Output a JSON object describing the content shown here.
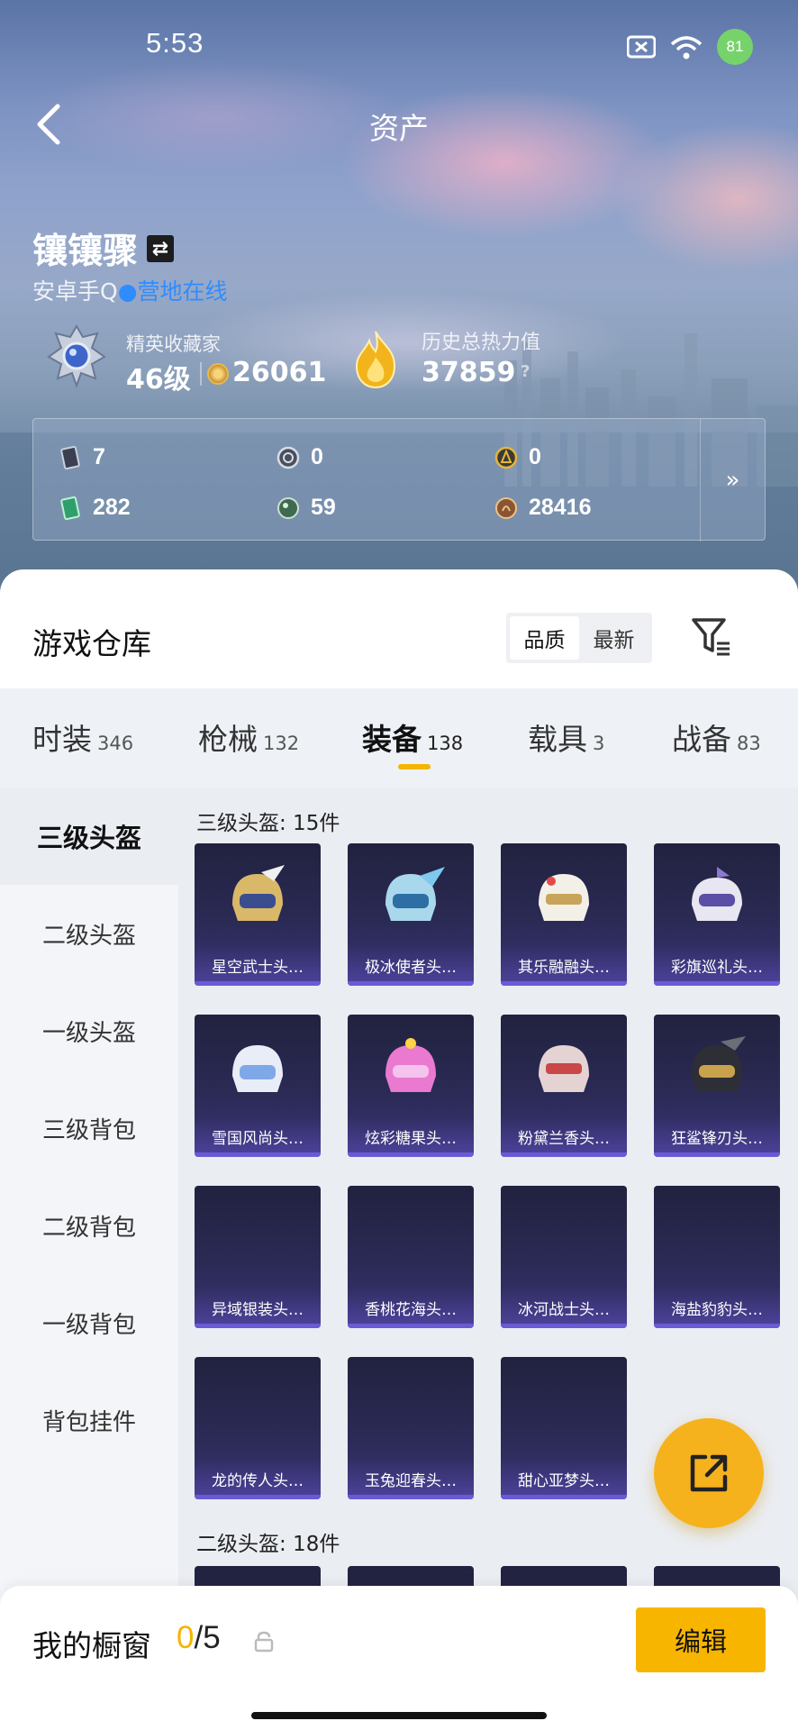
{
  "status_bar": {
    "time": "5:53",
    "battery": "81"
  },
  "header": {
    "title": "资产"
  },
  "user": {
    "name": "镶镶骤",
    "platform": "安卓手Q",
    "status": "营地在线",
    "rank_title": "精英收藏家",
    "level": "46级",
    "coins": "26061",
    "heat_title": "历史总热力值",
    "heat_value": "37859",
    "heat_help": "?"
  },
  "currencies": [
    {
      "icon": "card-icon",
      "value": "7"
    },
    {
      "icon": "silver-coin-icon",
      "value": "0"
    },
    {
      "icon": "gold-coin-icon",
      "value": "0"
    },
    {
      "icon": "green-ticket-icon",
      "value": "282"
    },
    {
      "icon": "orb-icon",
      "value": "59"
    },
    {
      "icon": "bronze-coin-icon",
      "value": "28416"
    }
  ],
  "currency_more": "»",
  "warehouse": {
    "title": "游戏仓库",
    "sort_quality": "品质",
    "sort_latest": "最新"
  },
  "tabs": [
    {
      "label": "时装",
      "count": "346"
    },
    {
      "label": "枪械",
      "count": "132"
    },
    {
      "label": "装备",
      "count": "138"
    },
    {
      "label": "载具",
      "count": "3"
    },
    {
      "label": "战备",
      "count": "83"
    }
  ],
  "active_tab": "装备",
  "sidebar": [
    "三级头盔",
    "二级头盔",
    "一级头盔",
    "三级背包",
    "二级背包",
    "一级背包",
    "背包挂件"
  ],
  "sections": [
    {
      "title": "三级头盔: 15件",
      "items": [
        "星空武士头…",
        "极冰使者头…",
        "其乐融融头…",
        "彩旗巡礼头…",
        "雪国风尚头…",
        "炫彩糖果头…",
        "粉黛兰香头…",
        "狂鲨锋刃头…",
        "异域银装头…",
        "香桃花海头…",
        "冰河战士头…",
        "海盐豹豹头…",
        "龙的传人头…",
        "玉兔迎春头…",
        "甜心亚梦头…"
      ]
    },
    {
      "title": "二级头盔: 18件"
    }
  ],
  "showcase": {
    "label": "我的橱窗",
    "current": "0",
    "total": "/5",
    "edit": "编辑"
  },
  "colors": {
    "accent": "#f5b400",
    "card_bg": "#2b2a55",
    "online": "#2f8cff"
  }
}
